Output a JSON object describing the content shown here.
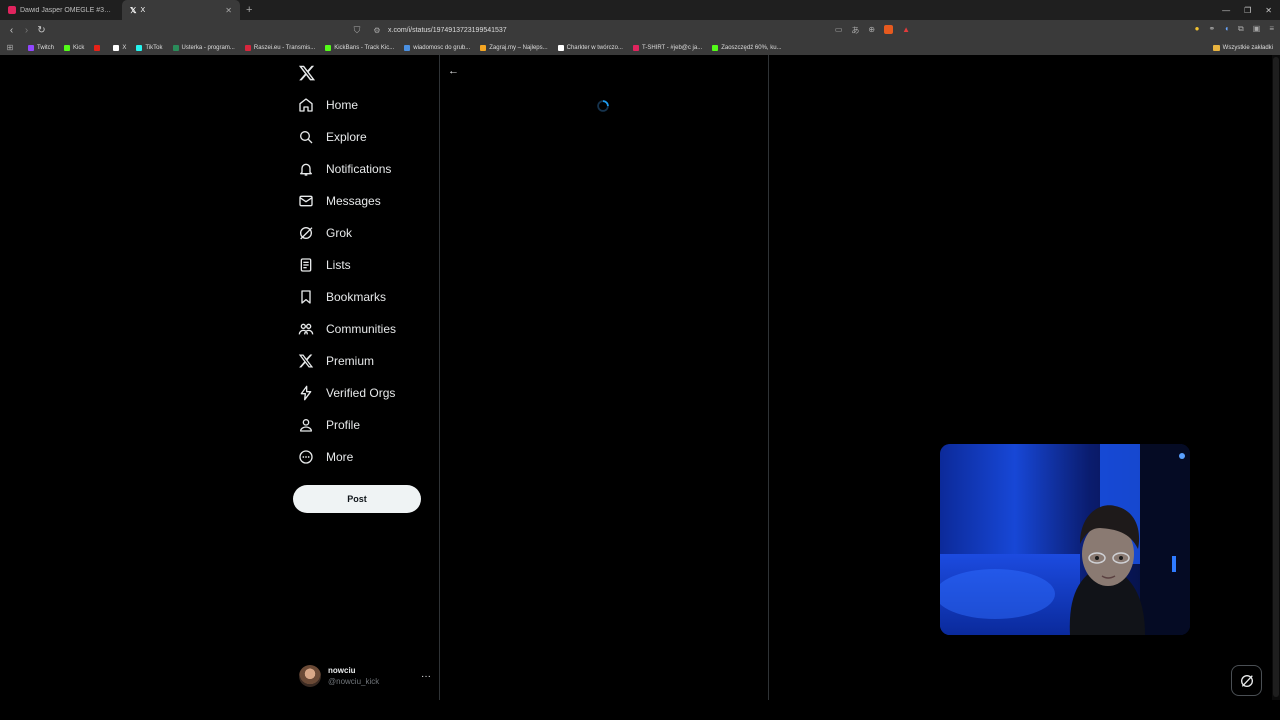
{
  "browser": {
    "tabs": [
      {
        "title": "Dawid Jasper OMEGLE #36 - Pojedy...",
        "favicon_color": "#e0245e"
      },
      {
        "title": "X",
        "favicon_color": "#ffffff"
      }
    ],
    "new_tab": "+",
    "address_url": "x.com/i/status/1974913723199541537",
    "bookmarks": [
      {
        "label": "Twitch",
        "color": "#9146ff"
      },
      {
        "label": "Kick",
        "color": "#53fc18"
      },
      {
        "label": "",
        "color": "#e62117"
      },
      {
        "label": "X",
        "color": "#ffffff"
      },
      {
        "label": "TikTok",
        "color": "#25f4ee"
      },
      {
        "label": "Usterka - program...",
        "color": "#2a8c5a"
      },
      {
        "label": "Raszei.eu - Transmis...",
        "color": "#d7263d"
      },
      {
        "label": "KickBans - Track Kic...",
        "color": "#53fc18"
      },
      {
        "label": "wiadomosc do grub...",
        "color": "#4a90e2"
      },
      {
        "label": "Zagraj.my – Najleps...",
        "color": "#f5a623"
      },
      {
        "label": "Charkter w twórczo...",
        "color": "#ffffff"
      },
      {
        "label": "T-SHIRT - #jeb@c ja...",
        "color": "#e0245e"
      },
      {
        "label": "Zaoszczędź 60%, ku...",
        "color": "#53fc18"
      }
    ],
    "bookmarks_folder": "Wszystkie zakładki"
  },
  "sidebar": {
    "items": [
      {
        "label": "Home",
        "icon": "home-icon"
      },
      {
        "label": "Explore",
        "icon": "search-icon"
      },
      {
        "label": "Notifications",
        "icon": "bell-icon"
      },
      {
        "label": "Messages",
        "icon": "envelope-icon"
      },
      {
        "label": "Grok",
        "icon": "grok-icon"
      },
      {
        "label": "Lists",
        "icon": "list-icon"
      },
      {
        "label": "Bookmarks",
        "icon": "bookmark-icon"
      },
      {
        "label": "Communities",
        "icon": "people-icon"
      },
      {
        "label": "Premium",
        "icon": "x-logo-icon"
      },
      {
        "label": "Verified Orgs",
        "icon": "lightning-icon"
      },
      {
        "label": "Profile",
        "icon": "person-icon"
      },
      {
        "label": "More",
        "icon": "more-circle-icon"
      }
    ],
    "post_label": "Post",
    "account": {
      "name": "nowciu",
      "handle": "@nowciu_kick"
    }
  },
  "colors": {
    "background": "#000000",
    "text": "#e7e9ea",
    "muted": "#71767b",
    "border": "#2f3336",
    "accent": "#1d9bf0"
  }
}
